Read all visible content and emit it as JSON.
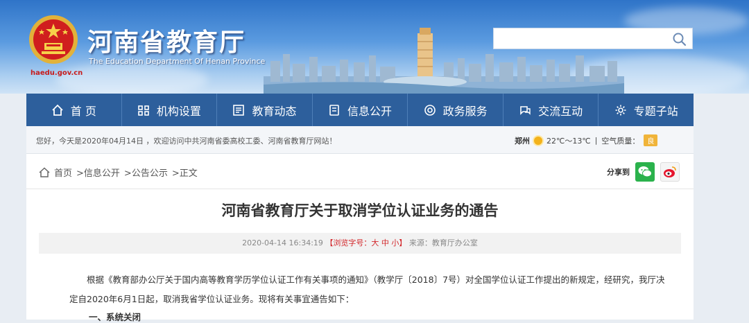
{
  "header": {
    "site_title": "河南省教育厅",
    "site_subtitle": "The Education Department Of Henan Province",
    "site_url": "haedu.gov.cn",
    "search_placeholder": ""
  },
  "nav": {
    "items": [
      {
        "label": "首 页",
        "icon": "home-icon"
      },
      {
        "label": "机构设置",
        "icon": "org-chart-icon"
      },
      {
        "label": "教育动态",
        "icon": "news-icon"
      },
      {
        "label": "信息公开",
        "icon": "info-icon"
      },
      {
        "label": "政务服务",
        "icon": "service-icon"
      },
      {
        "label": "交流互动",
        "icon": "interact-icon"
      },
      {
        "label": "专题子站",
        "icon": "gear-icon"
      }
    ]
  },
  "strip": {
    "welcome": "您好，今天是2020年04月14日 ，欢迎访问中共河南省委高校工委、河南省教育厅网站！",
    "city": "郑州",
    "temperature": "22℃～13℃",
    "aqi_label": "空气质量：",
    "aqi_value": "良"
  },
  "breadcrumb": {
    "home": "首页",
    "level1": ">信息公开",
    "level2": ">公告公示",
    "level3": ">正文"
  },
  "share": {
    "label": "分享到"
  },
  "article": {
    "title": "河南省教育厅关于取消学位认证业务的通告",
    "date": "2020-04-14 16:34:19",
    "font_prefix": "【浏览字号：",
    "font_large": "大",
    "font_medium": "中",
    "font_small": "小",
    "font_suffix": "】",
    "source": "来源：教育厅办公室",
    "paragraph1": "根据《教育部办公厅关于国内高等教育学历学位认证工作有关事项的通知》（教学厅〔2018〕7号）对全国学位认证工作提出的新规定，经研究，我厅决定自2020年6月1日起，取消我省学位认证业务。现将有关事宜通告如下：",
    "paragraph2": "一、系统关闭"
  },
  "colors": {
    "nav_bg": "#2d5f9c",
    "accent_red": "#d2262a",
    "wechat_green": "#2bb24c",
    "aqi_badge": "#f0b43a"
  }
}
